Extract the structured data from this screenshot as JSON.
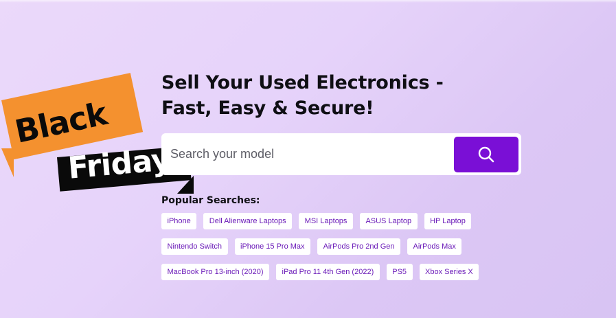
{
  "hero": {
    "headline_line1": "Sell Your Used Electronics -",
    "headline_line2": "Fast, Easy & Secure!"
  },
  "search": {
    "placeholder": "Search your model",
    "button_icon": "search-icon"
  },
  "promo": {
    "line1": "Black",
    "line2": "Friday",
    "tag_color_primary": "#f4912f",
    "tag_color_secondary": "#0a0a0a"
  },
  "popular": {
    "title": "Popular Searches:",
    "rows": [
      [
        "iPhone",
        "Dell Alienware Laptops",
        "MSI Laptops",
        "ASUS Laptop",
        "HP Laptop"
      ],
      [
        "Nintendo Switch",
        "iPhone 15 Pro Max",
        "AirPods Pro 2nd Gen",
        "AirPods Max"
      ],
      [
        "MacBook Pro 13-inch (2020)",
        "iPad Pro 11 4th Gen (2022)",
        "PS5",
        "Xbox Series X"
      ]
    ]
  },
  "colors": {
    "accent": "#7a0fd6",
    "chip_text": "#6a1ab8",
    "background": "#e6d3fa"
  }
}
